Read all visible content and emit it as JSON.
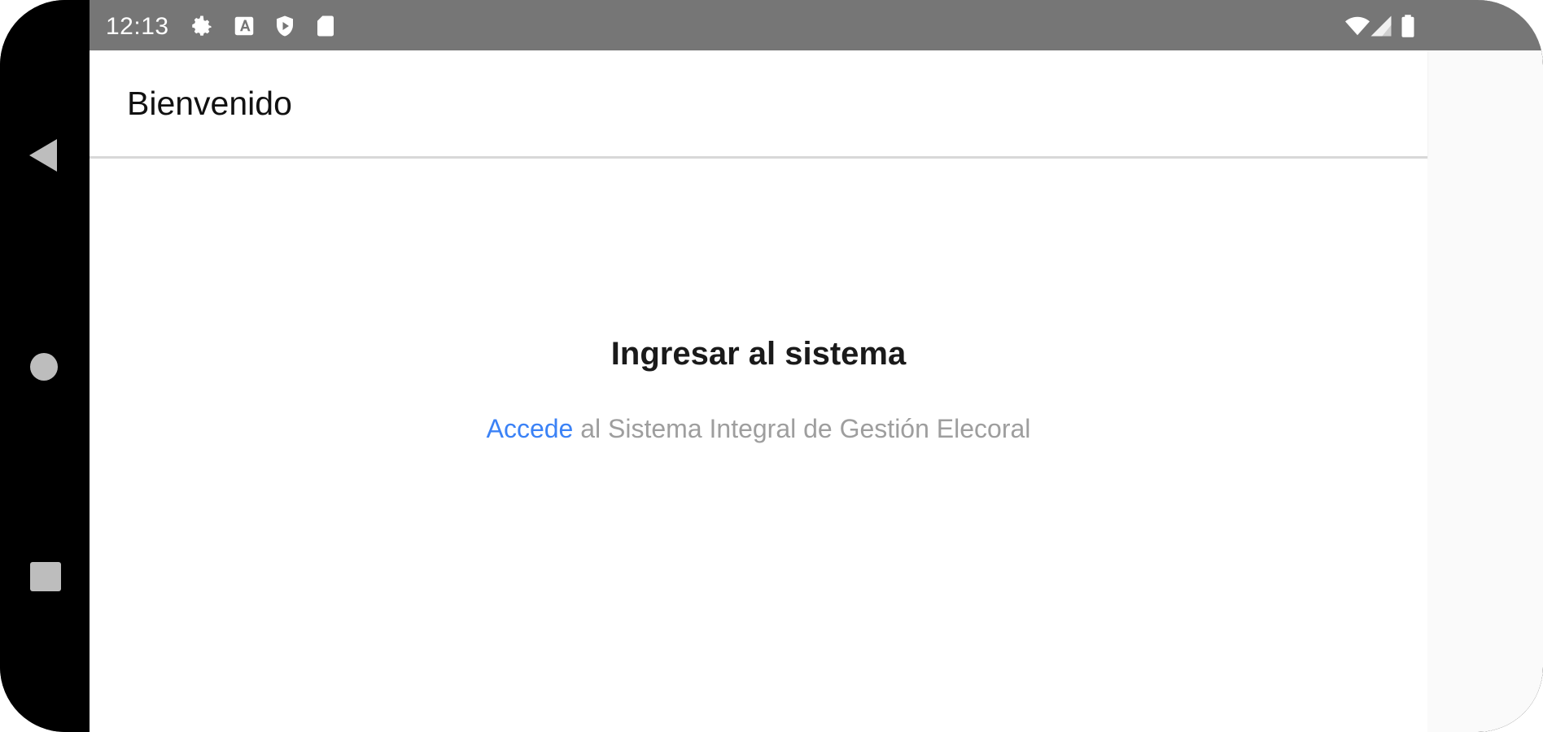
{
  "status_bar": {
    "time": "12:13",
    "icons": [
      "settings-icon",
      "a-icon",
      "shield-play-icon",
      "sd-card-icon",
      "wifi-icon",
      "signal-icon",
      "battery-icon"
    ]
  },
  "navigation": {
    "buttons": [
      "back-icon",
      "home-icon",
      "recents-icon"
    ]
  },
  "toolbar": {
    "title": "Bienvenido"
  },
  "login": {
    "title": "Ingresar al sistema",
    "link_text": "Accede",
    "subtitle_rest": " al Sistema Integral de Gestión Elecoral"
  },
  "colors": {
    "status_bar": "#767676",
    "link": "#3b82f6",
    "subtitle": "#9e9e9e"
  }
}
